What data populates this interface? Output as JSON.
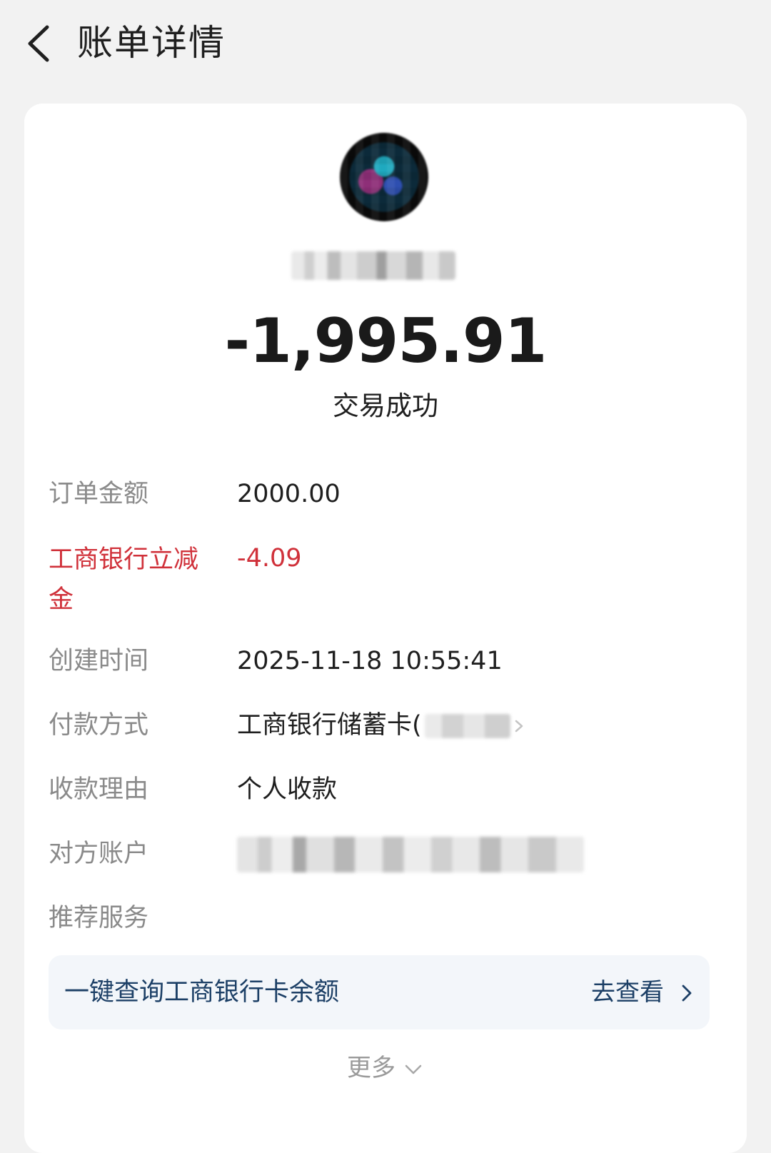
{
  "header": {
    "title": "账单详情",
    "back_icon": "chevron-left-icon"
  },
  "transaction": {
    "amount": "-1,995.91",
    "status": "交易成功"
  },
  "details": {
    "order_amount_label": "订单金额",
    "order_amount_value": "2000.00",
    "discount_label": "工商银行立减金",
    "discount_value": "-4.09",
    "created_label": "创建时间",
    "created_value": "2025-11-18 10:55:41",
    "payment_label": "付款方式",
    "payment_value": "工商银行储蓄卡(",
    "reason_label": "收款理由",
    "reason_value": "个人收款",
    "counterparty_label": "对方账户",
    "recommend_label": "推荐服务"
  },
  "recommend": {
    "text": "一键查询工商银行卡余额",
    "action": "去查看"
  },
  "more": {
    "label": "更多"
  },
  "colors": {
    "background": "#f2f2f2",
    "card": "#ffffff",
    "label_gray": "#8a8a8a",
    "highlight_red": "#d0313a",
    "link_navy": "#1c3f66",
    "recommend_bg": "#f3f6fa"
  }
}
